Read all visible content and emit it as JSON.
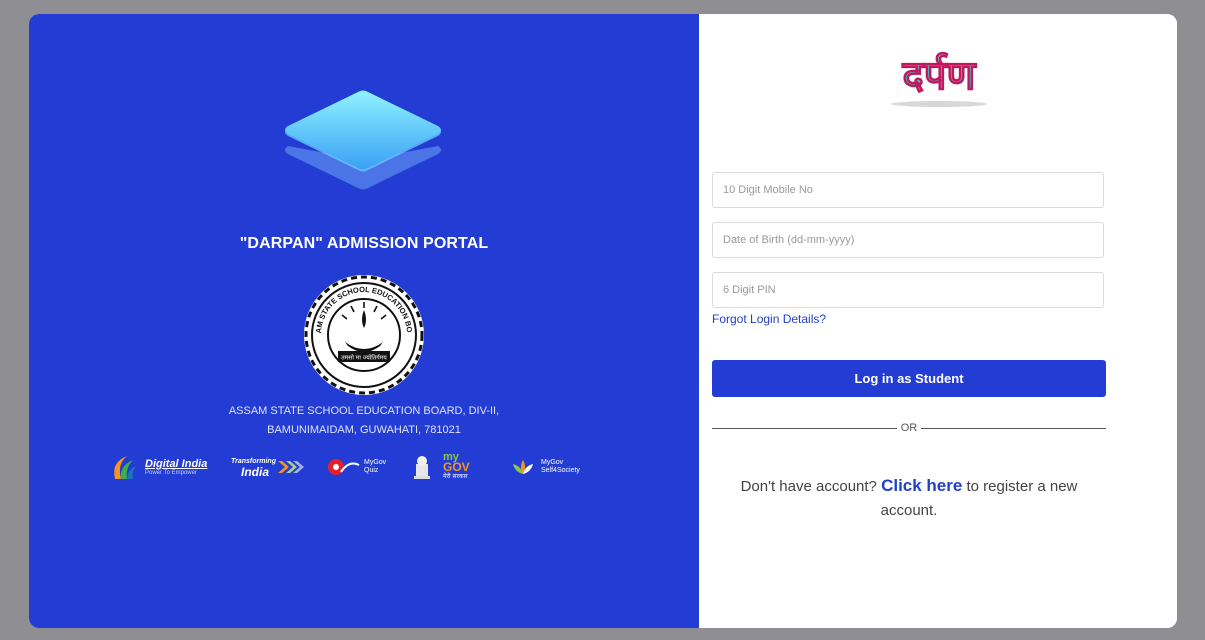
{
  "left_panel": {
    "title": "\"DARPAN\" ADMISSION PORTAL",
    "seal_text_top": "ASSAM STATE SCHOOL EDUCATION BOARD",
    "seal_motto": "तमसो मा ज्योतिर्गमय",
    "address_line1": "ASSAM STATE SCHOOL EDUCATION BOARD, DIV-II,",
    "address_line2": "BAMUNIMAIDAM, GUWAHATI, 781021",
    "partners": {
      "digital_india_title": "Digital India",
      "digital_india_sub": "Power To Empower",
      "transforming_top": "Transforming",
      "transforming_main": "India",
      "quiz_label_1": "MyGov",
      "quiz_label_2": "Quiz",
      "mygov_my": "my",
      "mygov_gov": "GOV",
      "mygov_sub": "मेरी सरकार",
      "self4society_1": "MyGov",
      "self4society_2": "Self4Society"
    }
  },
  "right_panel": {
    "logo_text": "दर्पण",
    "mobile_placeholder": "10 Digit Mobile No",
    "dob_placeholder": "Date of Birth (dd-mm-yyyy)",
    "pin_placeholder": "6 Digit PIN",
    "forgot_link": "Forgot Login Details?",
    "login_button": "Log in as Student",
    "or_text": "OR",
    "register_prefix": "Don't have account?",
    "register_link": "Click here",
    "register_suffix": " to register a new account."
  },
  "colors": {
    "brand_blue": "#233dd4",
    "link_blue": "#2040cc",
    "page_bg": "#8f8e93"
  }
}
